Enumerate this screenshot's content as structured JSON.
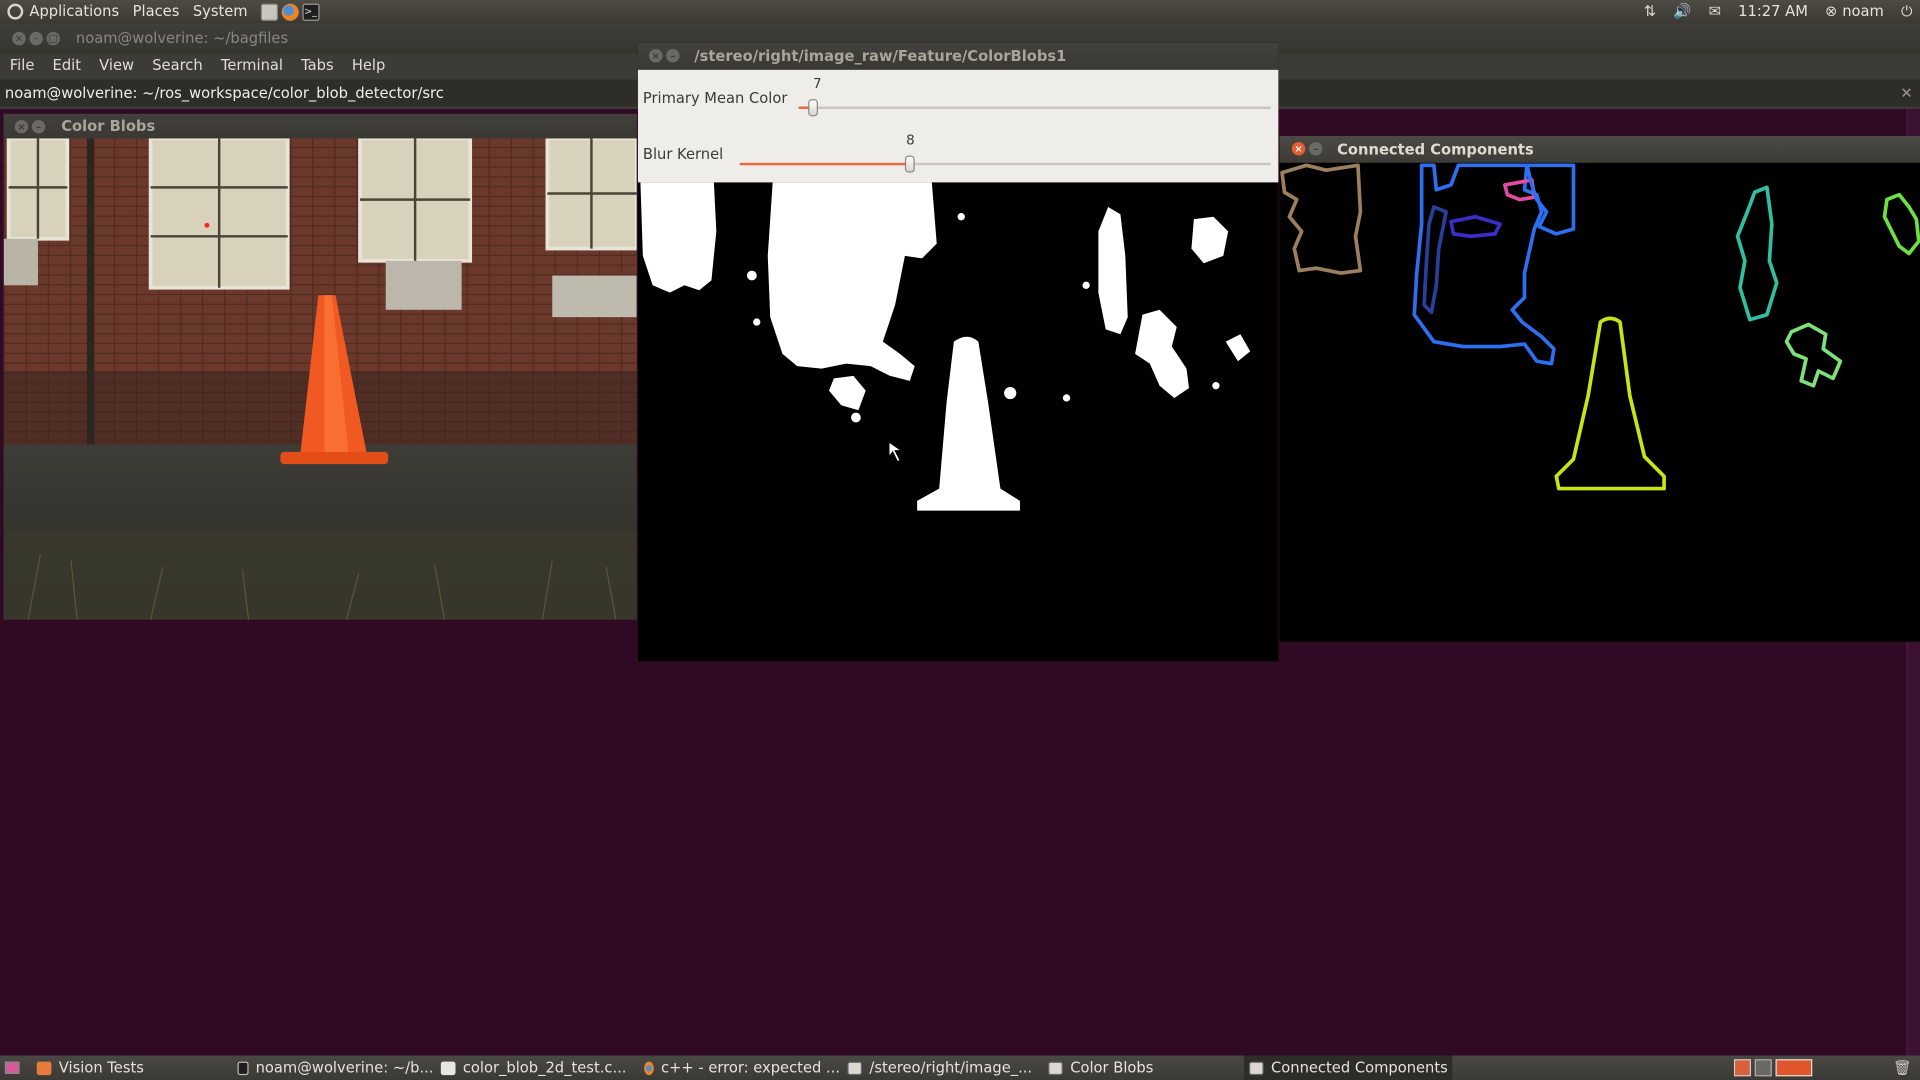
{
  "top_panel": {
    "menus": [
      "Applications",
      "Places",
      "System"
    ],
    "time": "11:27 AM",
    "user": "noam"
  },
  "terminal": {
    "title": "noam@wolverine: ~/bagfiles",
    "menus": [
      "File",
      "Edit",
      "View",
      "Search",
      "Terminal",
      "Tabs",
      "Help"
    ],
    "tab_title": "noam@wolverine: ~/ros_workspace/color_blob_detector/src"
  },
  "color_blobs_window": {
    "title": "Color Blobs"
  },
  "feature_window": {
    "title": "/stereo/right/image_raw/Feature/ColorBlobs1",
    "sliders": [
      {
        "label": "Primary Mean Color",
        "value": "7",
        "fraction": 0.03
      },
      {
        "label": "Blur Kernel",
        "value": "8",
        "fraction": 0.32
      }
    ]
  },
  "connected_window": {
    "title": "Connected Components"
  },
  "taskbar": {
    "items": [
      {
        "label": "Vision Tests",
        "icon": "folder-icon"
      },
      {
        "label": "noam@wolverine: ~/b...",
        "icon": "terminal-icon"
      },
      {
        "label": "color_blob_2d_test.c...",
        "icon": "text-editor-icon"
      },
      {
        "label": "c++ - error: expected ...",
        "icon": "firefox-icon"
      },
      {
        "label": "/stereo/right/image_...",
        "icon": "window-icon"
      },
      {
        "label": "Color Blobs",
        "icon": "window-icon"
      },
      {
        "label": "Connected Components",
        "icon": "window-icon"
      }
    ]
  },
  "colors": {
    "accent_orange": "#e96a3a",
    "panel_bg": "#3c3b37",
    "desktop_aubergine": "#300a24"
  }
}
